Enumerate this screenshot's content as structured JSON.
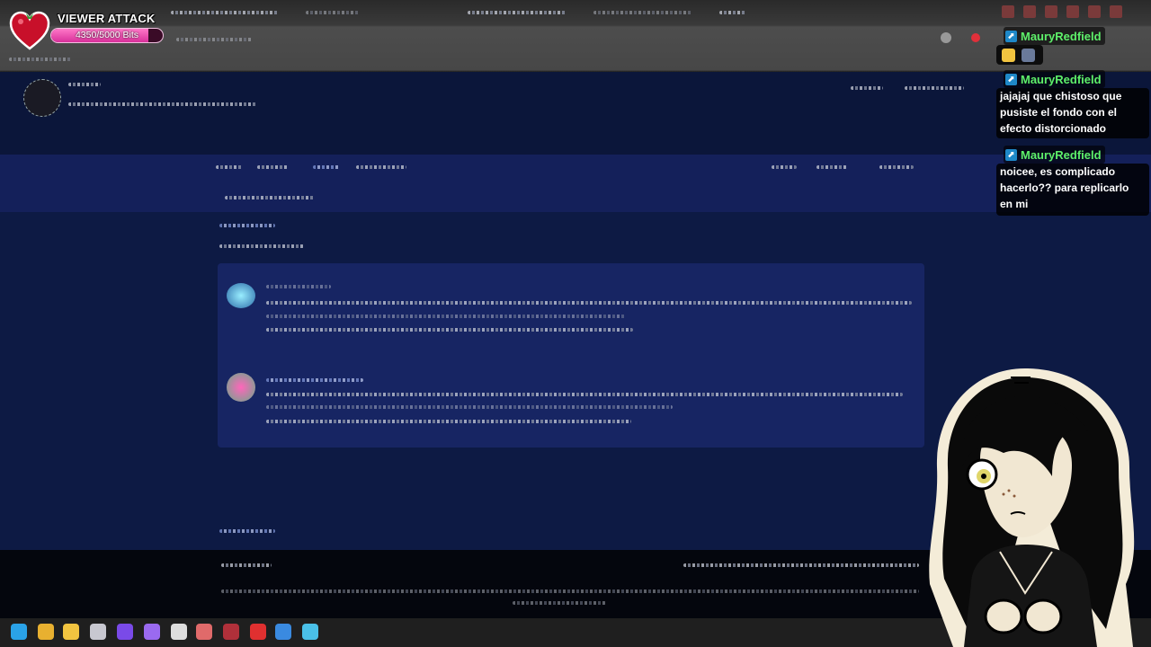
{
  "overlay": {
    "viewer_attack": {
      "title": "VIEWER ATTACK",
      "progress_label": "4350/5000 Bits",
      "progress_fraction": 0.87,
      "accent": "#e03a8f"
    }
  },
  "chat": {
    "messages": [
      {
        "username": "MauryRedfield",
        "text": ""
      },
      {
        "username": "MauryRedfield",
        "text": "jajajaj que chistoso que pusiste el fondo con el efecto distorcionado"
      },
      {
        "username": "MauryRedfield",
        "text": "noicee, es complicado hacerlo?? para replicarlo en mi"
      }
    ],
    "username_color": "#5ef06a"
  },
  "colors": {
    "page_bg": "#0d1a44",
    "card_bg": "#172563",
    "footer_bg": "#04060d"
  },
  "icons": {
    "overlay": [
      "heart-icon",
      "twitch-badge-icon"
    ],
    "taskbar": [
      "app-icon"
    ]
  }
}
